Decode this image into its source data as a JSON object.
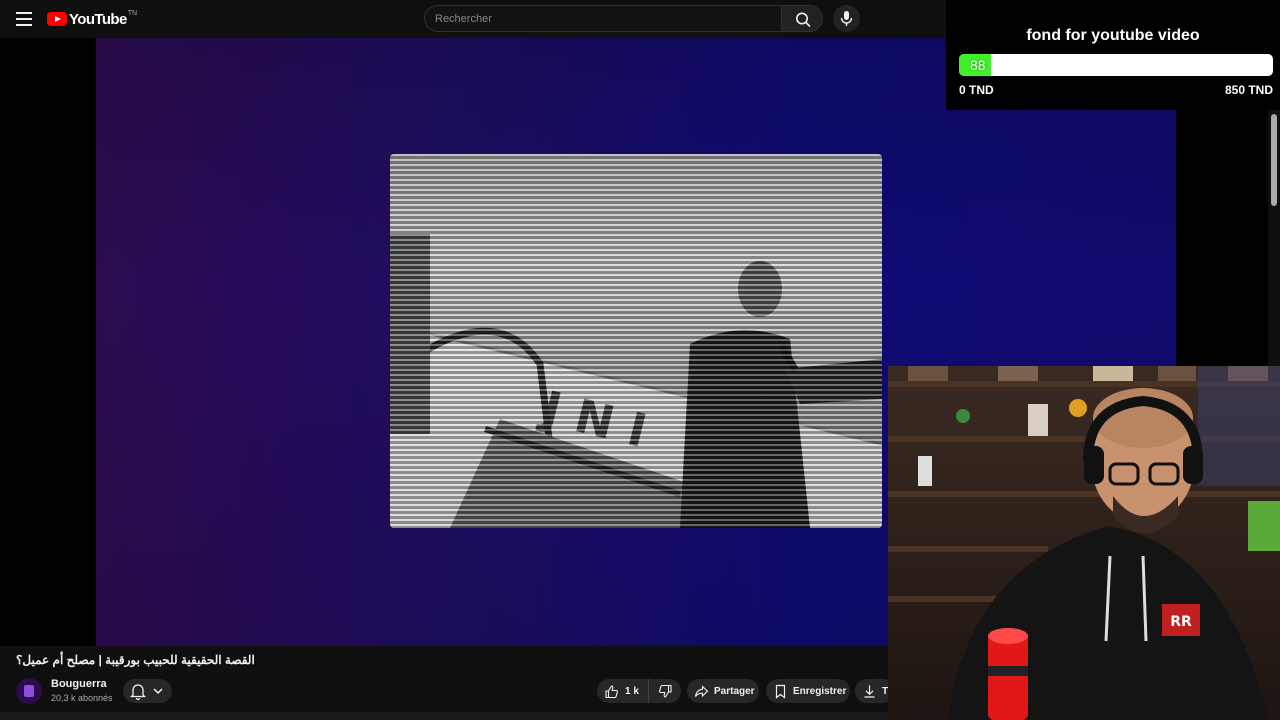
{
  "app": {
    "name": "YouTube",
    "logo_sup": "TN"
  },
  "search": {
    "placeholder": "Rechercher"
  },
  "video": {
    "title": "القصة الحقيقية للحبيب بورقيبة | مصلح أم عميل؟"
  },
  "channel": {
    "name": "Bouguerra",
    "subscribers": "20,3 k abonnés"
  },
  "actions": {
    "like_count": "1 k",
    "share_label": "Partager",
    "save_label": "Enregistrer",
    "download_label": "Télécharger"
  },
  "donation": {
    "title": "fond for youtube video",
    "current": "88",
    "progress": 0.1035,
    "min_label": "0 TND",
    "max_label": "850 TND",
    "fill_color": "#3ff02a"
  }
}
